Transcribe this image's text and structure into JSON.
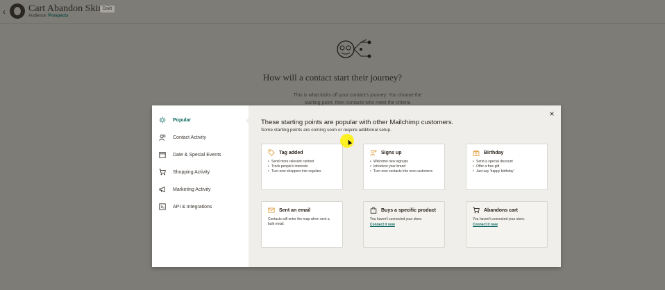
{
  "header": {
    "back_icon": "chevron-left-icon",
    "title": "Cart Abandon Skin 1",
    "status_badge": "Draft",
    "audience_label": "Audience:",
    "audience_value": "Prospects"
  },
  "background": {
    "heading": "How will a contact start their journey?",
    "description": "This is what kicks off your contact's journey. You choose the starting point, then contacts who meet the criteria"
  },
  "modal": {
    "close_label": "×",
    "heading": "These starting points are popular with other Mailchimp customers.",
    "subheading": "Some starting points are coming soon or require additional setup.",
    "sidebar": [
      {
        "label": "Popular",
        "icon": "sun-icon",
        "active": true
      },
      {
        "label": "Contact Activity",
        "icon": "people-icon",
        "active": false
      },
      {
        "label": "Date & Special Events",
        "icon": "calendar-icon",
        "active": false
      },
      {
        "label": "Shopping Activity",
        "icon": "cart-icon",
        "active": false
      },
      {
        "label": "Marketing Activity",
        "icon": "megaphone-icon",
        "active": false
      },
      {
        "label": "API & Integrations",
        "icon": "api-icon",
        "active": false
      }
    ],
    "cards": [
      {
        "title": "Tag added",
        "icon": "tag-icon",
        "bullets": [
          "Send more relevant content",
          "Track people's interests",
          "Turn new shoppers into regulars"
        ]
      },
      {
        "title": "Signs up",
        "icon": "user-plus-icon",
        "bullets": [
          "Welcome new signups",
          "Introduce your brand",
          "Turn new contacts into new customers"
        ]
      },
      {
        "title": "Birthday",
        "icon": "gift-icon",
        "bullets": [
          "Send a special discount",
          "Offer a free gift",
          "Just say 'happy birthday'"
        ]
      },
      {
        "title": "Sent an email",
        "icon": "envelope-icon",
        "description": "Contacts will enter the map when sent a bulk email."
      },
      {
        "title": "Buys a specific product",
        "icon": "bag-icon",
        "description": "You haven't connected your store.",
        "link": "Connect it now"
      },
      {
        "title": "Abandons cart",
        "icon": "cart-icon",
        "description": "You haven't connected your store.",
        "link": "Connect it now"
      }
    ]
  },
  "colors": {
    "accent": "#0f6b63",
    "overlay": "#7e7c77",
    "highlight": "#fff000"
  }
}
